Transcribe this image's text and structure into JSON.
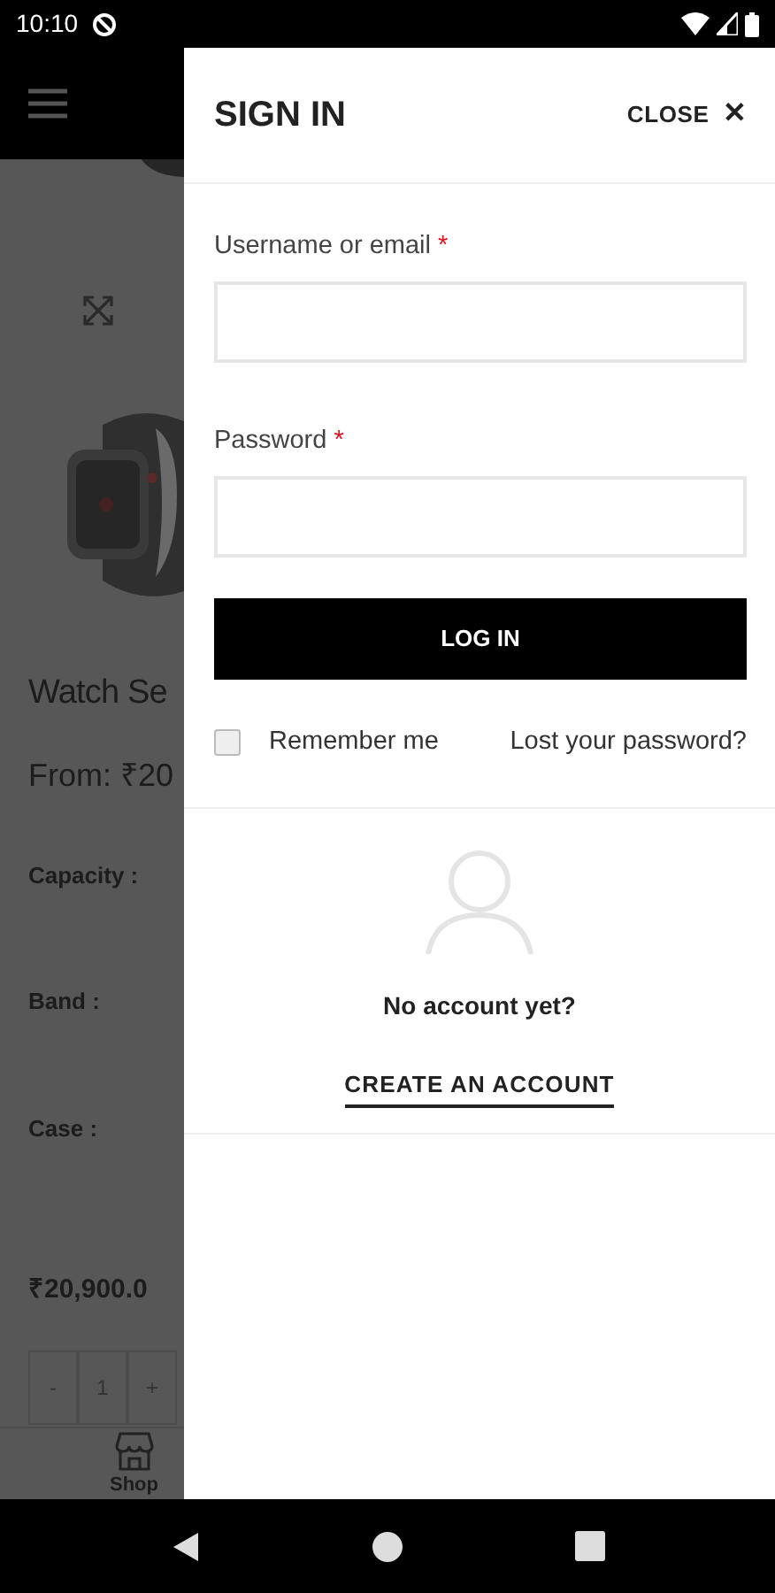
{
  "status_bar": {
    "time": "10:10"
  },
  "background_page": {
    "product": {
      "title": "Watch Se",
      "price": "From: ₹20",
      "options": [
        "Capacity :",
        "Band :",
        "Case :"
      ],
      "total": "₹20,900.0",
      "quantity": {
        "minus": "-",
        "value": "1",
        "plus": "+"
      }
    },
    "bottom_nav": [
      {
        "label": "Shop"
      }
    ]
  },
  "drawer": {
    "title": "SIGN IN",
    "close": "CLOSE",
    "close_icon": "✕",
    "fields": [
      {
        "label": "Username or email",
        "required_mark": "*"
      },
      {
        "label": "Password",
        "required_mark": "*"
      }
    ],
    "login_button": "LOG IN",
    "remember": {
      "label": "Remember me",
      "checked": false
    },
    "lost_password": "Lost your password?",
    "register": {
      "prompt": "No account yet?",
      "link": "CREATE AN ACCOUNT"
    }
  }
}
